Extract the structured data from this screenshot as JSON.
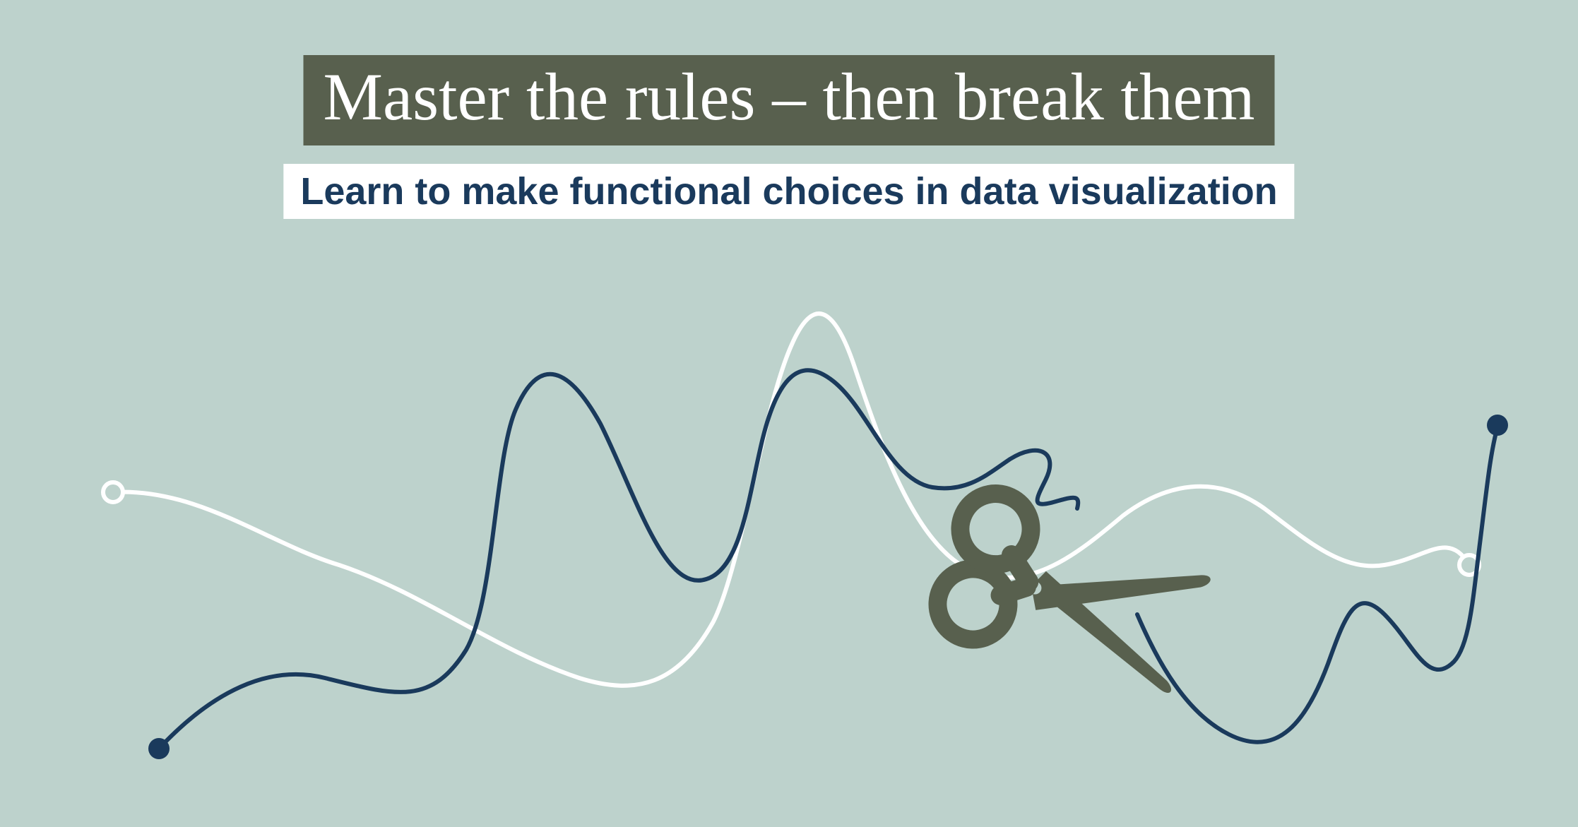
{
  "title": "Master the rules – then break them",
  "subtitle": "Learn to make functional choices in data visualization",
  "colors": {
    "background": "#bdd2cc",
    "title_bg": "#58604e",
    "title_text": "#ffffff",
    "subtitle_bg": "#ffffff",
    "subtitle_text": "#1a3a5c",
    "line_dark": "#1a3a5c",
    "line_light": "#ffffff",
    "scissors": "#58604e"
  }
}
